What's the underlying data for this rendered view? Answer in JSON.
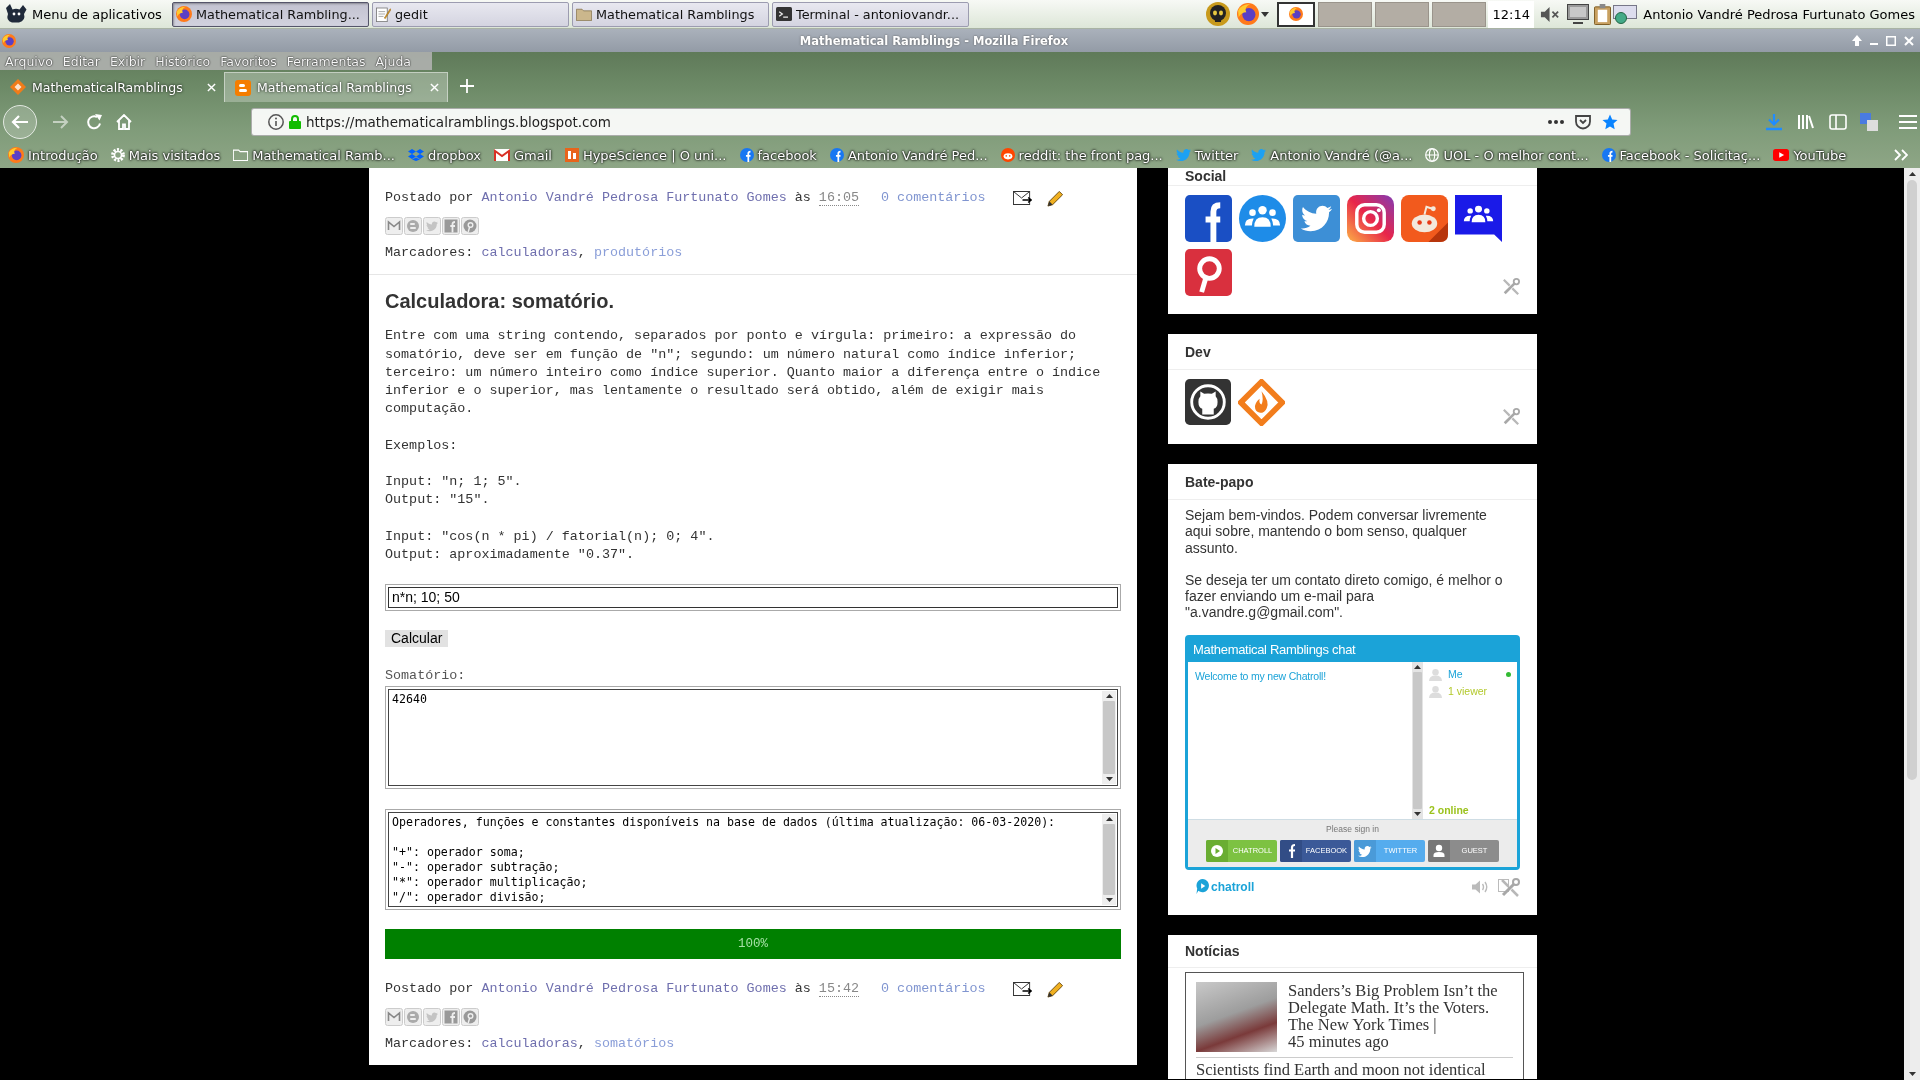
{
  "taskbar": {
    "menu_button": "Menu de aplicativos",
    "tasks": [
      {
        "label": "Mathematical Rambling...",
        "kind": "browser",
        "selected": true
      },
      {
        "label": "gedit",
        "kind": "notepad",
        "selected": false
      },
      {
        "label": "Mathematical Ramblings",
        "kind": "folder",
        "selected": false
      },
      {
        "label": "Terminal - antoniovandr...",
        "kind": "terminal",
        "selected": false
      }
    ],
    "workspaces": [
      {
        "kind": "browser",
        "selected": true
      },
      {
        "kind": "empty",
        "selected": false
      },
      {
        "kind": "empty",
        "selected": false
      },
      {
        "kind": "empty",
        "selected": false
      }
    ],
    "clock": "12:14",
    "user": "Antonio Vandré Pedrosa Furtunato Gomes"
  },
  "window": {
    "title": "Mathematical Ramblings - Mozilla Firefox"
  },
  "menu_bar": [
    "Arquivo",
    "Editar",
    "Exibir",
    "Histórico",
    "Favoritos",
    "Ferramentas",
    "Ajuda"
  ],
  "tabs": [
    {
      "label": "MathematicalRamblings",
      "kind": "diamond",
      "selected": false
    },
    {
      "label": "Mathematical Ramblings",
      "kind": "blog",
      "selected": true
    }
  ],
  "address_bar": {
    "url": "https://mathematicalramblings.blogspot.com",
    "bookmarked": true
  },
  "bookmarks": [
    {
      "label": "Introdução",
      "kind": "browser"
    },
    {
      "label": "Mais visitados",
      "kind": "gear"
    },
    {
      "label": "Mathematical Ramb...",
      "kind": "folder"
    },
    {
      "label": "dropbox",
      "kind": "diamonds"
    },
    {
      "label": "Gmail",
      "kind": "mail"
    },
    {
      "label": "HypeScience | O uni...",
      "kind": "badge"
    },
    {
      "label": "facebook",
      "kind": "facebook"
    },
    {
      "label": "Antonio Vandré Ped...",
      "kind": "facebook"
    },
    {
      "label": "reddit: the front pag...",
      "kind": "reddit"
    },
    {
      "label": "Twitter",
      "kind": "bird"
    },
    {
      "label": "Antonio Vandré (@a...",
      "kind": "bird"
    },
    {
      "label": "UOL - O melhor cont...",
      "kind": "globe"
    },
    {
      "label": "Facebook - Solicitaç...",
      "kind": "facebook"
    },
    {
      "label": "YouTube",
      "kind": "video"
    }
  ],
  "posts": [
    {
      "footer": {
        "by": "Postado por",
        "author": "Antonio Vandré Pedrosa Furtunato Gomes",
        "at": "às",
        "time": "16:05",
        "comments": "0 comentários",
        "labels_caption": "Marcadores:",
        "label_separator": ",",
        "labels": [
          {
            "text": "calculadoras",
            "visited": true
          },
          {
            "text": "produtórios",
            "visited": false
          }
        ]
      }
    },
    {
      "title": "Calculadora: somatório.",
      "description": "Entre com uma string contendo, separados por ponto e vírgula: primeiro: a expressão do somatório, deve ser em função de \"n\"; segundo: um número natural como índice inferior; terceiro: um número inteiro como índice superior. Quanto maior a diferença entre o índice inferior e o superior, mas lentamente o resultado será obtido, além de exigir mais computação.",
      "examples_label": "Exemplos:",
      "examples": [
        {
          "input": "Input: \"n; 1; 5\".",
          "output": "Output: \"15\"."
        },
        {
          "input": "Input: \"cos(n * pi) / fatorial(n); 0; 4\".",
          "output": "Output: aproximadamente \"0.37\"."
        }
      ],
      "calculator": {
        "input": {
          "value": "n*n; 10; 50"
        },
        "button": "Calcular",
        "result_label": "Somatório:",
        "result": "42640",
        "reference": {
          "heading": "Operadores, funções e constantes disponíveis na base de dados (última atualização: 06-03-2020):",
          "lines": [
            "\"+\": operador soma;",
            "\"-\": operador subtração;",
            "\"*\": operador multiplicação;",
            "\"/\": operador divisão;"
          ]
        },
        "progress": {
          "level": 1,
          "label": "100%"
        }
      },
      "footer": {
        "by": "Postado por",
        "author": "Antonio Vandré Pedrosa Furtunato Gomes",
        "at": "às",
        "time": "15:42",
        "comments": "0 comentários",
        "labels_caption": "Marcadores:",
        "label_separator": ",",
        "labels": [
          {
            "text": "calculadoras",
            "visited": true
          },
          {
            "text": "somatórios",
            "visited": false
          }
        ]
      }
    }
  ],
  "sidebar": {
    "social": {
      "title": "Social",
      "links": [
        {
          "kind": "facebook"
        },
        {
          "kind": "people"
        },
        {
          "kind": "bird"
        },
        {
          "kind": "camera"
        },
        {
          "kind": "reddit"
        },
        {
          "kind": "group-chat"
        },
        {
          "kind": "pin"
        }
      ]
    },
    "dev": {
      "title": "Dev",
      "links": [
        {
          "kind": "cat"
        },
        {
          "kind": "flame-diamond"
        }
      ]
    },
    "chat": {
      "title": "Bate-papo",
      "paragraphs": [
        "Sejam bem-vindos. Podem conversar livremente aqui sobre, mantendo o bom senso, qualquer assunto.",
        "Se deseja ter um contato direto comigo, é melhor o fazer enviando um e-mail para \"a.vandre.g@gmail.com\"."
      ],
      "chatroll": {
        "title": "Mathematical Ramblings chat",
        "messages": [
          "Welcome to my new Chatroll!"
        ],
        "users": [
          {
            "name": "Me",
            "kind": "member",
            "online": true
          },
          {
            "name": "1 viewer",
            "kind": "viewers",
            "online": false
          }
        ],
        "online_count": "2 online",
        "sign_in_prompt": "Please sign in",
        "sign_in_buttons": [
          {
            "label": "CHATROLL",
            "kind": "chatroll"
          },
          {
            "label": "FACEBOOK",
            "kind": "facebook"
          },
          {
            "label": "TWITTER",
            "kind": "twitter"
          },
          {
            "label": "GUEST",
            "kind": "guest"
          }
        ],
        "brand": "chatroll"
      }
    },
    "news": {
      "title": "Notícias",
      "items": [
        {
          "headline": "Sanders’s Big Problem Isn’t the Delegate Math. It’s the Voters.",
          "photo": true,
          "source": "The New York Times |",
          "age": "45 minutes ago"
        },
        {
          "headline": "Scientists find Earth and moon not identical"
        }
      ]
    }
  }
}
